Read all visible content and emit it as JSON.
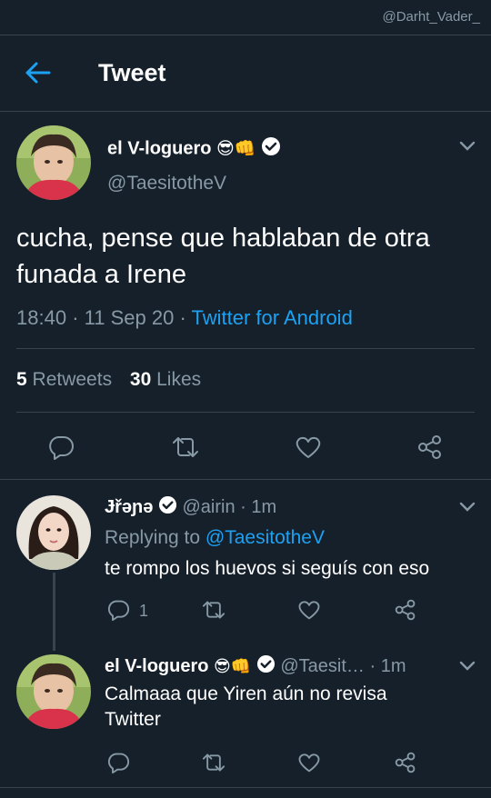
{
  "watermark": "@Darht_Vader_",
  "appbar": {
    "title": "Tweet"
  },
  "main_tweet": {
    "display_name": "el V-loguero",
    "emojis": "😎👊",
    "handle": "@TaesitotheV",
    "text": "cucha, pense que hablaban de otra funada a Irene",
    "time": "18:40",
    "date": "11 Sep 20",
    "source": "Twitter for Android",
    "retweets": "5",
    "retweets_label": "Retweets",
    "likes": "30",
    "likes_label": "Likes",
    "dot": "·"
  },
  "replies": [
    {
      "display_name": "Ɉřəɲə",
      "handle": "@airin",
      "time": "1m",
      "replying_label": "Replying to",
      "replying_to": "@TaesitotheV",
      "text": "te rompo los huevos si seguís con eso",
      "reply_count": "1",
      "dot": "·"
    },
    {
      "display_name": "el V-loguero",
      "emojis": "😎👊",
      "handle": "@Taesit…",
      "time": "1m",
      "text": "Calmaaa que Yiren aún no revisa Twitter",
      "dot": "·"
    }
  ],
  "colors": {
    "background": "#15202b",
    "accent": "#1da1f2",
    "muted": "#8899a6",
    "divider": "#38444d"
  }
}
